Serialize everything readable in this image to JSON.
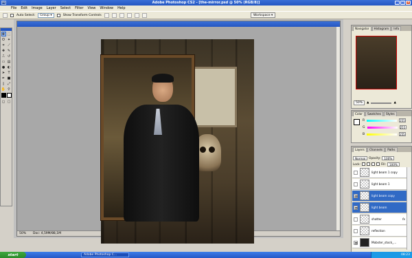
{
  "window": {
    "title": "Adobe Photoshop CS2 - [the-mirror.psd @ 50% (RGB/8)]",
    "logo_text": "Ps",
    "controls": [
      "_",
      "□",
      "X"
    ]
  },
  "menu": [
    "File",
    "Edit",
    "Image",
    "Layer",
    "Select",
    "Filter",
    "View",
    "Window",
    "Help"
  ],
  "options_bar": {
    "auto_select_label": "Auto Select:",
    "auto_select_value": "Group",
    "show_transform_label": "Show Transform Controls",
    "workspace_label": "Workspace"
  },
  "document": {
    "title": "",
    "zoom": "50%",
    "doc_size": "Doc: 4,59M/88,1M"
  },
  "navigator": {
    "tabs": [
      "Navigator",
      "Histogram",
      "Info"
    ],
    "zoom": "50%"
  },
  "color": {
    "tabs": [
      "Color",
      "Swatches",
      "Styles"
    ],
    "channels": [
      {
        "label": "R",
        "value": "255",
        "color": "#ff4040"
      },
      {
        "label": "G",
        "value": "255",
        "color": "#40d040"
      },
      {
        "label": "B",
        "value": "255",
        "color": "#4040ff"
      }
    ]
  },
  "layers": {
    "tabs": [
      "Layers",
      "Channels",
      "Paths"
    ],
    "blend_mode": "Normal",
    "opacity_label": "Opacity:",
    "opacity": "100%",
    "lock_label": "Lock:",
    "fill_label": "Fill:",
    "fill": "100%",
    "items": [
      {
        "name": "light beam 1 copy",
        "visible": false,
        "selected": false
      },
      {
        "name": "light beam 1",
        "visible": false,
        "selected": false
      },
      {
        "name": "light beam copy",
        "visible": true,
        "selected": true
      },
      {
        "name": "light beam",
        "visible": true,
        "selected": true
      },
      {
        "name": "shatter",
        "visible": false,
        "selected": false,
        "fx": "fx"
      },
      {
        "name": "reflection",
        "visible": false,
        "selected": false
      },
      {
        "name": "Mobster_stock_...",
        "visible": true,
        "selected": false
      }
    ]
  },
  "taskbar": {
    "start": "start",
    "task_item": "Adobe Photoshop C...",
    "clock": "08:23"
  }
}
